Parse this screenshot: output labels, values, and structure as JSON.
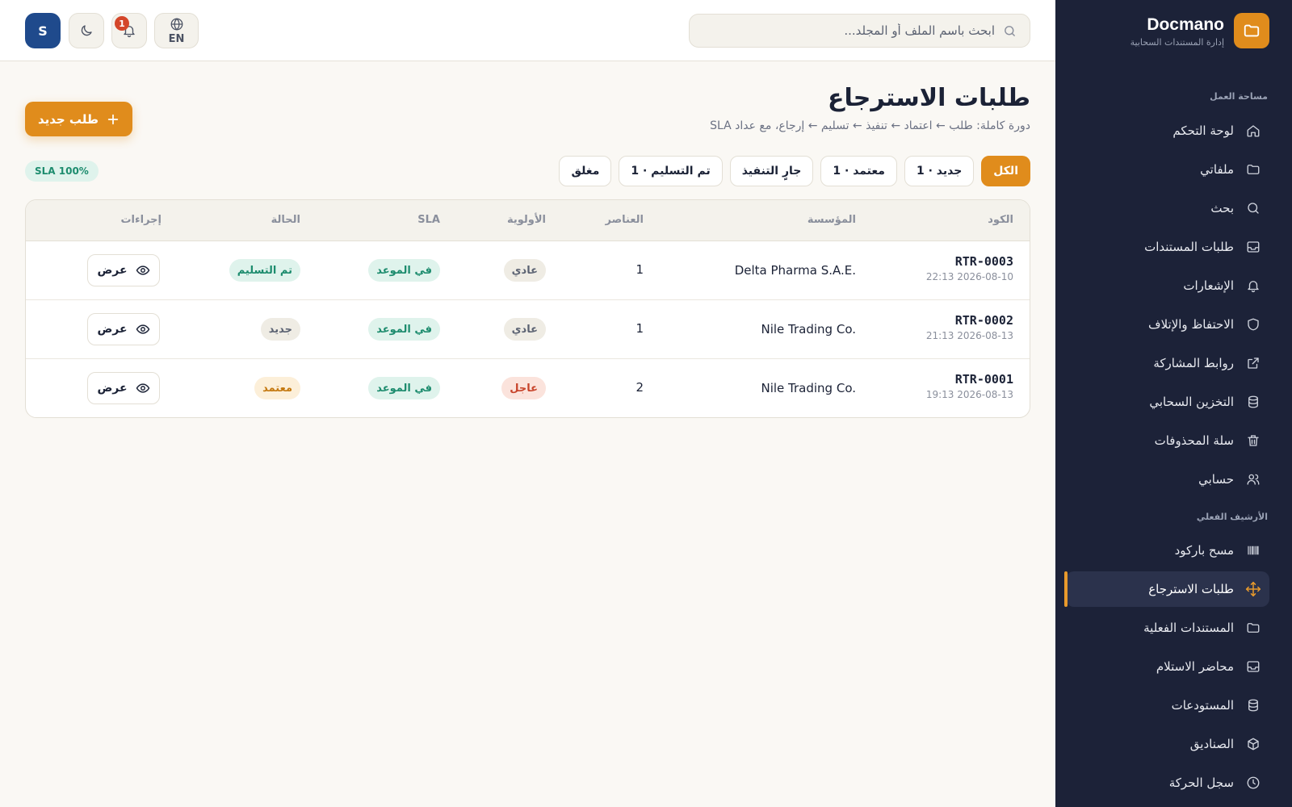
{
  "brand": {
    "name": "Docmano",
    "tagline": "إدارة المستندات السحابية"
  },
  "sidebar": {
    "section_workspace": "مساحة العمل",
    "section_archive": "الأرشيف الفعلي",
    "items": [
      {
        "label": "لوحة التحكم",
        "icon": "home-icon"
      },
      {
        "label": "ملفاتي",
        "icon": "folder-icon"
      },
      {
        "label": "بحث",
        "icon": "search-icon"
      },
      {
        "label": "طلبات المستندات",
        "icon": "inbox-icon"
      },
      {
        "label": "الإشعارات",
        "icon": "bell-icon"
      },
      {
        "label": "الاحتفاظ والإتلاف",
        "icon": "shield-icon"
      },
      {
        "label": "روابط المشاركة",
        "icon": "external-link-icon"
      },
      {
        "label": "التخزين السحابي",
        "icon": "database-icon"
      },
      {
        "label": "سلة المحذوفات",
        "icon": "trash-icon"
      },
      {
        "label": "حسابي",
        "icon": "users-icon"
      }
    ],
    "archive_items": [
      {
        "label": "مسح باركود",
        "icon": "barcode-icon"
      },
      {
        "label": "طلبات الاسترجاع",
        "icon": "move-icon",
        "active": true
      },
      {
        "label": "المستندات الفعلية",
        "icon": "folder-icon"
      },
      {
        "label": "محاضر الاستلام",
        "icon": "inbox-icon"
      },
      {
        "label": "المستودعات",
        "icon": "database-icon"
      },
      {
        "label": "الصناديق",
        "icon": "box-icon"
      },
      {
        "label": "سجل الحركة",
        "icon": "clock-icon"
      }
    ]
  },
  "topbar": {
    "search_placeholder": "ابحث باسم الملف أو المجلد...",
    "lang": "EN",
    "notification_count": "1",
    "avatar_initial": "S"
  },
  "page": {
    "title": "طلبات الاسترجاع",
    "subtitle": "دورة كاملة: طلب ← اعتماد ← تنفيذ ← تسليم ← إرجاع، مع عداد SLA",
    "new_button": "طلب جديد"
  },
  "filters": [
    "الكل",
    "جديد · 1",
    "معتمد · 1",
    "جارٍ التنفيذ",
    "تم التسليم · 1",
    "مغلق"
  ],
  "sla_summary": "SLA 100%",
  "table": {
    "headers": {
      "code": "الكود",
      "org": "المؤسسة",
      "items": "العناصر",
      "priority": "الأولوية",
      "sla": "SLA",
      "status": "الحالة",
      "actions": "إجراءات"
    },
    "view_label": "عرض",
    "rows": [
      {
        "code": "RTR-0003",
        "date": "2026-08-10 22:13",
        "org": "Delta Pharma S.A.E.",
        "items": "1",
        "priority": "عادي",
        "sla": "في الموعد",
        "status": "تم التسليم"
      },
      {
        "code": "RTR-0002",
        "date": "2026-08-13 21:13",
        "org": "Nile Trading Co.",
        "items": "1",
        "priority": "عادي",
        "sla": "في الموعد",
        "status": "جديد"
      },
      {
        "code": "RTR-0001",
        "date": "2026-08-13 19:13",
        "org": "Nile Trading Co.",
        "items": "2",
        "priority": "عاجل",
        "sla": "في الموعد",
        "status": "معتمد"
      }
    ]
  },
  "colors": {
    "sidebar_bg": "#1c2238",
    "accent": "#e08c1c",
    "success": "#1d8c6e",
    "danger": "#c7432a"
  }
}
